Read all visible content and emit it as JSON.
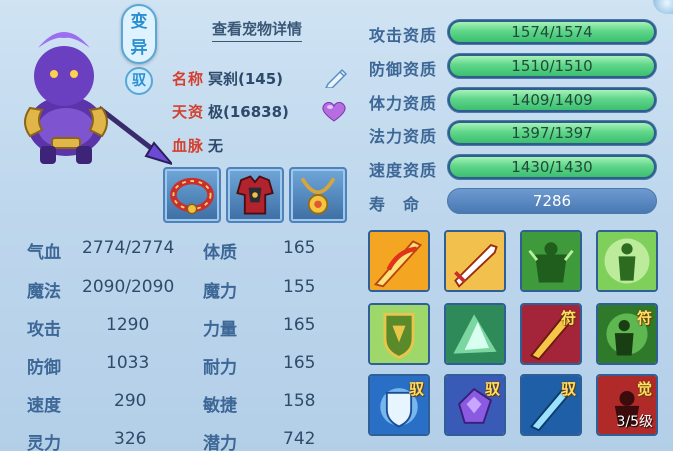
{
  "pet": {
    "badge_mutant": "变异",
    "badge_tamed": "驭",
    "detail_link": "查看宠物详情",
    "name_label": "名称",
    "name_value": "冥刹(145)",
    "talent_label": "天资",
    "talent_value": "极(16838)",
    "bloodline_label": "血脉",
    "bloodline_value": "无"
  },
  "equipment": [
    {
      "name": "collar-icon"
    },
    {
      "name": "armor-icon"
    },
    {
      "name": "necklace-icon"
    }
  ],
  "stats": {
    "hp_label": "气血",
    "hp_value": "2774/2774",
    "mp_label": "魔法",
    "mp_value": "2090/2090",
    "atk_label": "攻击",
    "atk_value": "1290",
    "def_label": "防御",
    "def_value": "1033",
    "spd_label": "速度",
    "spd_value": "290",
    "spirit_label": "灵力",
    "spirit_value": "326",
    "con_label": "体质",
    "con_value": "165",
    "mag_label": "魔力",
    "mag_value": "155",
    "str_label": "力量",
    "str_value": "165",
    "end_label": "耐力",
    "end_value": "165",
    "agi_label": "敏捷",
    "agi_value": "158",
    "pot_label": "潜力",
    "pot_value": "742"
  },
  "aptitudes": [
    {
      "label": "攻击资质",
      "value": "1574/1574",
      "fill": 1.0
    },
    {
      "label": "防御资质",
      "value": "1510/1510",
      "fill": 1.0
    },
    {
      "label": "体力资质",
      "value": "1409/1409",
      "fill": 1.0
    },
    {
      "label": "法力资质",
      "value": "1397/1397",
      "fill": 1.0
    },
    {
      "label": "速度资质",
      "value": "1430/1430",
      "fill": 1.0
    }
  ],
  "life": {
    "label": "寿　命",
    "value": "7286"
  },
  "skills": {
    "tag_fu": "符",
    "tag_yu": "驭",
    "tag_jue": "觉",
    "awaken_level": "3/5级"
  },
  "colors": {
    "accent_red": "#d3402f",
    "bar_green": "#5fd68a",
    "label_blue": "#3d6796"
  }
}
